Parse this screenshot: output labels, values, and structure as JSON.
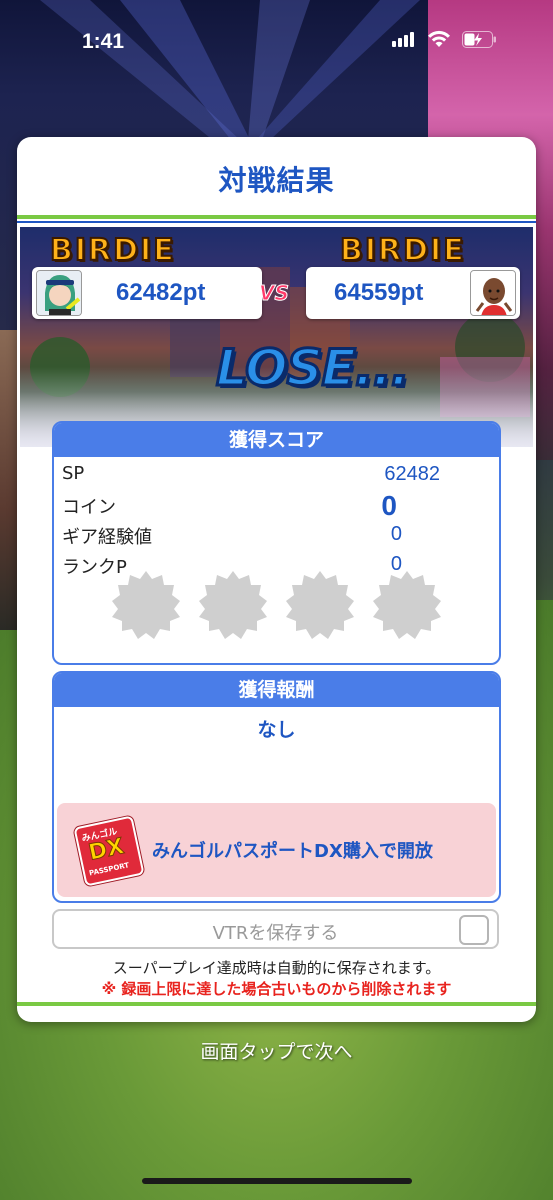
{
  "status_bar": {
    "time": "1:41"
  },
  "dialog": {
    "title": "対戦結果",
    "banner": {
      "left_badge": "BIRDIE",
      "right_badge": "BIRDIE",
      "player_score": "62482pt",
      "opponent_score": "64559pt",
      "vs": "VS",
      "result": "LOSE..."
    },
    "score_panel": {
      "title": "獲得スコア",
      "rows": [
        {
          "label": "SP",
          "value": "62482"
        },
        {
          "label": "コイン",
          "value": "0"
        },
        {
          "label": "ギア経験値",
          "value": "0"
        },
        {
          "label": "ランクP",
          "value": "0"
        }
      ]
    },
    "reward_panel": {
      "title": "獲得報酬",
      "none_text": "なし",
      "passport_icon_text": "みんゴル",
      "passport_icon_dx": "DX",
      "passport_icon_sub": "PASSPORT",
      "passport_button": "みんゴルパスポートDX購入で開放"
    },
    "vtr_button": "VTRを保存する",
    "note_auto_save": "スーパープレイ達成時は自動的に保存されます。",
    "note_warning": "※ 録画上限に達した場合古いものから削除されます"
  },
  "tap_next": "画面タップで次へ",
  "colors": {
    "accent_blue": "#1e56c2",
    "panel_blue": "#4a7de8",
    "green_line": "#7ac943",
    "warning_red": "#e8231e"
  }
}
